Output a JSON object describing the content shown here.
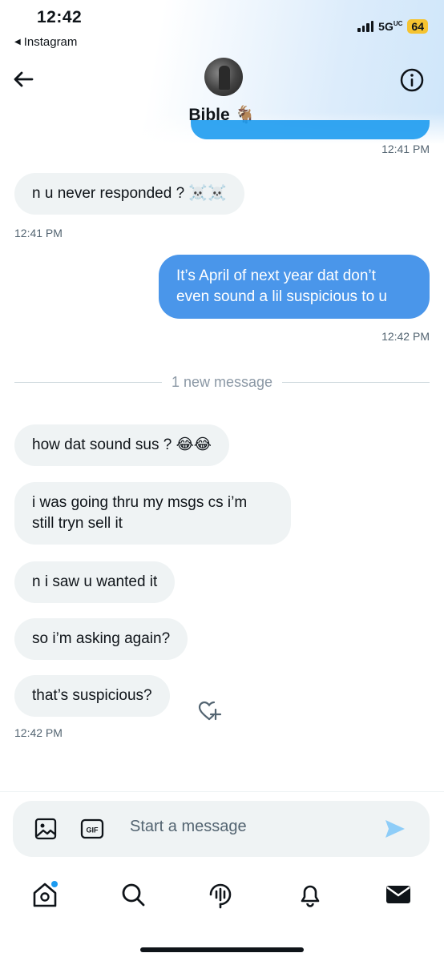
{
  "status_bar": {
    "time": "12:42",
    "back_app": "Instagram",
    "network": "5G",
    "network_sup": "UC",
    "battery": "64"
  },
  "header": {
    "contact_name": "Bible 🐐"
  },
  "messages": {
    "ts_top": "12:41 PM",
    "m1": "n u never responded ? ☠️☠️",
    "ts_m1": "12:41 PM",
    "m2_line1": "It’s April of next year dat don’t",
    "m2_line2": "even sound a lil suspicious to u",
    "ts_m2": "12:42 PM",
    "divider": "1 new message",
    "m3": "how dat sound sus ? 😂😂",
    "m4_line1": "i was going thru my msgs cs i’m",
    "m4_line2": "still tryn sell it",
    "m5": "n i saw u wanted it",
    "m6": "so i’m asking again?",
    "m7": "that’s suspicious?",
    "ts_m7": "12:42 PM"
  },
  "composer": {
    "placeholder": "Start a message",
    "gif_label": "GIF"
  },
  "icons": [
    "back-arrow-icon",
    "info-icon",
    "image-icon",
    "gif-icon",
    "send-icon",
    "heart-add-icon",
    "home-icon",
    "search-icon",
    "spaces-icon",
    "notifications-icon",
    "messages-icon"
  ],
  "colors": {
    "sent_bubble": "#4a96ea",
    "received_bubble": "#eff3f4",
    "accent": "#1d9bf0",
    "battery": "#f5c330"
  }
}
